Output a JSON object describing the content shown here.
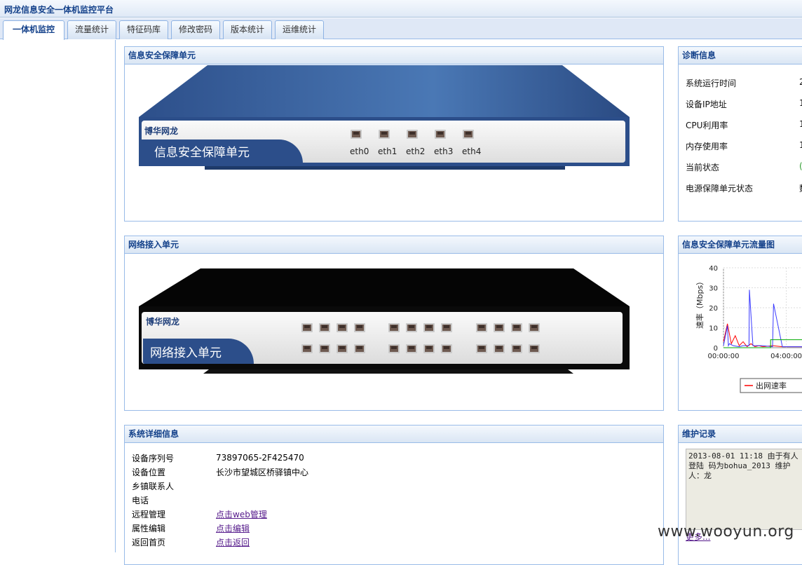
{
  "app": {
    "title": "网龙信息安全一体机监控平台"
  },
  "tabs": [
    {
      "label": "一体机监控",
      "active": true
    },
    {
      "label": "流量统计"
    },
    {
      "label": "特征码库"
    },
    {
      "label": "修改密码"
    },
    {
      "label": "版本统计"
    },
    {
      "label": "运维统计"
    }
  ],
  "security_unit": {
    "panel_title": "信息安全保障单元",
    "brand": "博华网龙",
    "device_label": "信息安全保障单元",
    "ports": [
      "eth0",
      "eth1",
      "eth2",
      "eth3",
      "eth4"
    ]
  },
  "network_unit": {
    "panel_title": "网络接入单元",
    "brand": "博华网龙",
    "device_label": "网络接入单元"
  },
  "diagnostics": {
    "panel_title": "诊断信息",
    "rows": [
      {
        "label": "系统运行时间",
        "value": "2"
      },
      {
        "label": "设备IP地址",
        "value": "1"
      },
      {
        "label": "CPU利用率",
        "value": "1"
      },
      {
        "label": "内存使用率",
        "value": "1"
      },
      {
        "label": "当前状态",
        "value": "("
      },
      {
        "label": "电源保障单元状态",
        "value": "数"
      }
    ]
  },
  "traffic_chart": {
    "panel_title": "信息安全保障单元流量图"
  },
  "chart_data": {
    "type": "line",
    "ylabel": "速率（Mbps）",
    "ylim": [
      0,
      40
    ],
    "yticks": [
      "0",
      "10",
      "20",
      "30",
      "40"
    ],
    "xticks": [
      "00:00:00",
      "04:00:00"
    ],
    "legend": [
      "出网速率",
      ""
    ],
    "series": [
      {
        "name": "出网速率",
        "color": "#ff0000",
        "x": [
          0,
          0.2,
          0.4,
          0.6,
          0.8,
          1.0,
          1.2,
          1.4,
          1.6,
          1.8,
          2.0,
          2.5,
          3.0,
          3.5,
          4.0,
          4.5,
          5.0
        ],
        "values": [
          3,
          12,
          2,
          6,
          1,
          3,
          0.5,
          2,
          0.5,
          1,
          0.5,
          1,
          0.5,
          0.5,
          0.5,
          0.5,
          0.5
        ]
      },
      {
        "color": "#3a3aff",
        "x": [
          0,
          0.2,
          0.25,
          0.3,
          0.5,
          0.8,
          1.0,
          1.3,
          1.32,
          1.5,
          2.0,
          2.5,
          2.55,
          3.0,
          4.0,
          5.0
        ],
        "values": [
          1,
          11,
          1,
          2,
          1,
          0.5,
          1,
          1,
          29,
          1,
          1,
          0.5,
          22,
          0.5,
          0.5,
          0.5
        ]
      },
      {
        "color": "#00aa00",
        "x": [
          0,
          2.4,
          2.4,
          5.0
        ],
        "values": [
          0,
          0,
          4,
          4
        ]
      }
    ]
  },
  "system_detail": {
    "panel_title": "系统详细信息",
    "rows": [
      {
        "label": "设备序列号",
        "value": "73897065-2F425470"
      },
      {
        "label": "设备位置",
        "value": "长沙市望城区桥驿镇中心"
      },
      {
        "label": "乡镇联系人",
        "value": ""
      },
      {
        "label": "电话",
        "value": ""
      },
      {
        "label": "远程管理",
        "link": "点击web管理"
      },
      {
        "label": "属性编辑",
        "link": "点击编辑"
      },
      {
        "label": "返回首页",
        "link": "点击返回"
      }
    ]
  },
  "maintenance": {
    "panel_title": "维护记录",
    "log_text": "2013-08-01 11:18  由于有人登陆 码为bohua_2013  维护人：龙",
    "more_link": "更多..."
  },
  "watermark": "www.wooyun.org",
  "colors": {
    "header_text": "#15428b",
    "panel_border": "#99bbe8"
  }
}
